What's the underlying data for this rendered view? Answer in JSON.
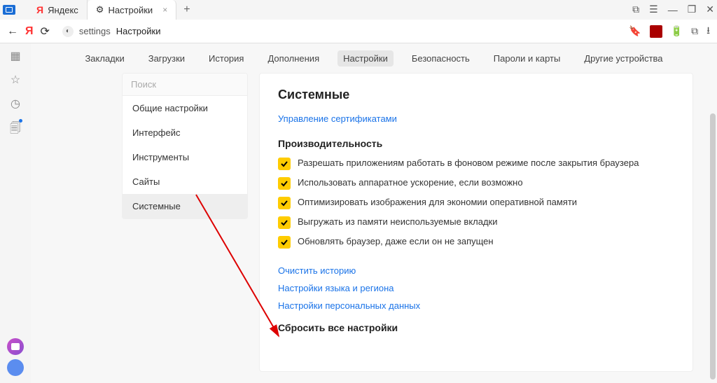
{
  "titlebar": {
    "empty": ""
  },
  "tabs": [
    {
      "icon": "Я",
      "label": "Яндекс"
    },
    {
      "icon": "⚙",
      "label": "Настройки"
    }
  ],
  "address": {
    "segment1": "settings",
    "segment2": "Настройки"
  },
  "topnav": {
    "items": [
      "Закладки",
      "Загрузки",
      "История",
      "Дополнения",
      "Настройки",
      "Безопасность",
      "Пароли и карты",
      "Другие устройства"
    ]
  },
  "sidebar": {
    "search_placeholder": "Поиск",
    "items": [
      "Общие настройки",
      "Интерфейс",
      "Инструменты",
      "Сайты",
      "Системные"
    ]
  },
  "main": {
    "title": "Системные",
    "cert_link": "Управление сертификатами",
    "perf_title": "Производительность",
    "checkboxes": [
      "Разрешать приложениям работать в фоновом режиме после закрытия браузера",
      "Использовать аппаратное ускорение, если возможно",
      "Оптимизировать изображения для экономии оперативной памяти",
      "Выгружать из памяти неиспользуемые вкладки",
      "Обновлять браузер, даже если он не запущен"
    ],
    "links": [
      "Очистить историю",
      "Настройки языка и региона",
      "Настройки персональных данных"
    ],
    "reset": "Сбросить все настройки"
  }
}
